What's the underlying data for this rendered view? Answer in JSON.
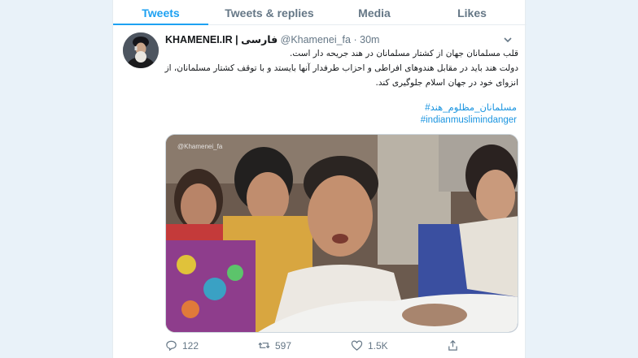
{
  "tabs": [
    {
      "label": "Tweets",
      "active": true
    },
    {
      "label": "Tweets & replies",
      "active": false
    },
    {
      "label": "Media",
      "active": false
    },
    {
      "label": "Likes",
      "active": false
    }
  ],
  "tweet": {
    "display_name": "KHAMENEI.IR",
    "separator": "|",
    "language": "فارسی",
    "handle": "@Khamenei_fa",
    "dot": "·",
    "time": "30m",
    "text_lines": [
      "قلب مسلمانان جهان از کشتار مسلمانان در هند جریحه دار است.",
      "دولت هند باید در مقابل هندوهای افراطی و احزاب طرفدار آنها بایستد و با توقف کشتار مسلمانان، از",
      "انزوای خود در جهان اسلام جلوگیری کند."
    ],
    "hashtags": [
      "#مسلمانان_مظلوم_هند",
      "#indianmuslimindanger"
    ],
    "image_watermark": "@Khamenei_fa",
    "stats": {
      "replies": "122",
      "retweets": "597",
      "likes": "1.5K"
    }
  },
  "colors": {
    "accent": "#1da1f2",
    "link": "#1b95e0",
    "muted": "#657786",
    "background": "#e9f2f9"
  },
  "icons": [
    "chevron-down-icon",
    "reply-icon",
    "retweet-icon",
    "like-icon",
    "share-icon"
  ]
}
